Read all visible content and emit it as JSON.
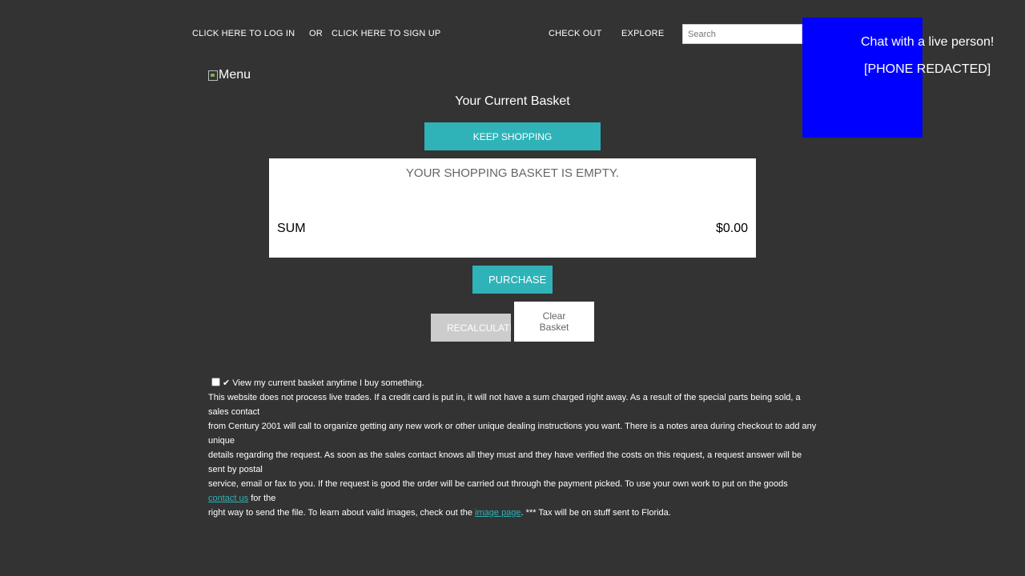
{
  "header": {
    "login_link": "CLICK HERE TO LOG IN",
    "or_text": "OR",
    "signup_link": "CLICK HERE TO SIGN UP",
    "checkout_link": "CHECK OUT",
    "explore_link": "EXPLORE",
    "search_placeholder": "Search"
  },
  "chat": {
    "title": "Chat with a live person!",
    "phone": "[PHONE REDACTED]"
  },
  "menu_image_alt": "Menu",
  "basket": {
    "title": "Your Current Basket",
    "keep_shopping": "KEEP SHOPPING",
    "empty_message": "YOUR SHOPPING BASKET IS EMPTY.",
    "sum_label": "SUM",
    "sum_value": "$0.00",
    "purchase": "PURCHASE",
    "recalculate": "RECALCULATE",
    "clear": "Clear Basket"
  },
  "footer": {
    "checkbox_label": "✔ View my current basket anytime I buy something.",
    "line1": "This website does not process live trades. If a credit card is put in, it will not have a sum charged right away. As a result of the special parts being sold, a sales contact",
    "line2": "from Century 2001 will call to organize getting any new work or other unique dealing instructions you want. There is a notes area during checkout to add any unique",
    "line3": "details regarding the request. As soon as the sales contact knows all they must and they have verified the costs on this request, a request answer will be sent by postal",
    "line4a": "service, email or fax to you. If the request is good the order will be carried out through the payment picked. To use your own work to put on the goods ",
    "contact_link": "contact us",
    "line4b": " for the",
    "line5a": "right way to send the file. To learn about valid images, check out the ",
    "image_link": "image page",
    "line5b": ". *** Tax will be on stuff sent to Florida."
  }
}
